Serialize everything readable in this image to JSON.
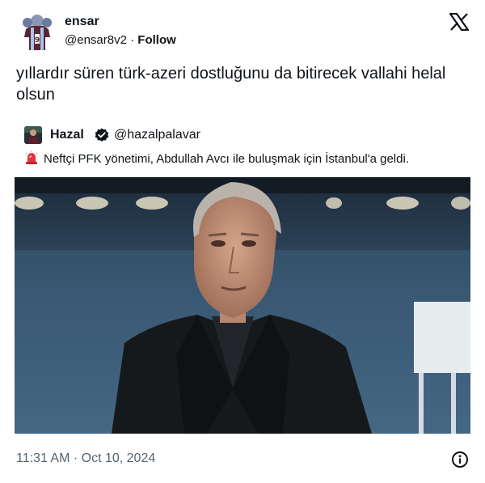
{
  "author": {
    "name": "ensar",
    "handle": "@ensar8v2",
    "separator": "·",
    "follow_label": "Follow",
    "avatar_icon": "team-jersey-avatar-icon"
  },
  "tweet": {
    "text": "yıllardır süren türk-azeri dostluğunu da bitirecek vallahi helal olsun",
    "timestamp": "11:31 AM · Oct 10, 2024"
  },
  "quoted": {
    "name": "Hazal",
    "handle": "@hazalpalavar",
    "verified": true,
    "text": "Neftçi PFK yönetimi, Abdullah Avcı ile buluşmak için İstanbul'a geldi.",
    "siren_icon": "police-siren-icon"
  },
  "photo": {
    "subject": "man-in-black-blazer-stadium-photo"
  },
  "icons": {
    "platform": "x-logo-icon",
    "info": "info-icon"
  },
  "colors": {
    "text": "#0f1419",
    "muted": "#536471",
    "verified": "#0f1419"
  }
}
